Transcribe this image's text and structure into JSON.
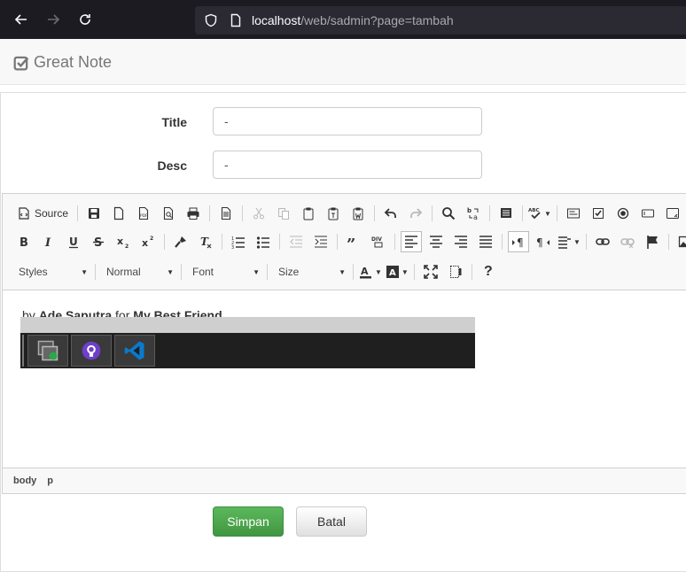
{
  "browser": {
    "url_host": "localhost",
    "url_path": "/web/sadmin?page=tambah"
  },
  "navbar": {
    "brand": "Great Note"
  },
  "form": {
    "title_label": "Title",
    "title_value": "-",
    "desc_label": "Desc",
    "desc_value": "-"
  },
  "editor": {
    "source_label": "Source",
    "combos": {
      "styles": "Styles",
      "format": "Normal",
      "font": "Font",
      "size": "Size"
    },
    "content": {
      "prefix": "by ",
      "author": "Ade Saputra",
      "middle": " for ",
      "friend": "My Best Friend"
    },
    "elements_path": [
      "body",
      "p"
    ],
    "help_label": "?"
  },
  "buttons": {
    "save": "Simpan",
    "cancel": "Batal"
  },
  "colors": {
    "save_button": "#4cae4c",
    "browser_bar": "#1c1b22",
    "vscode_blue": "#0a7acc",
    "github_purple": "#6e40c9"
  }
}
